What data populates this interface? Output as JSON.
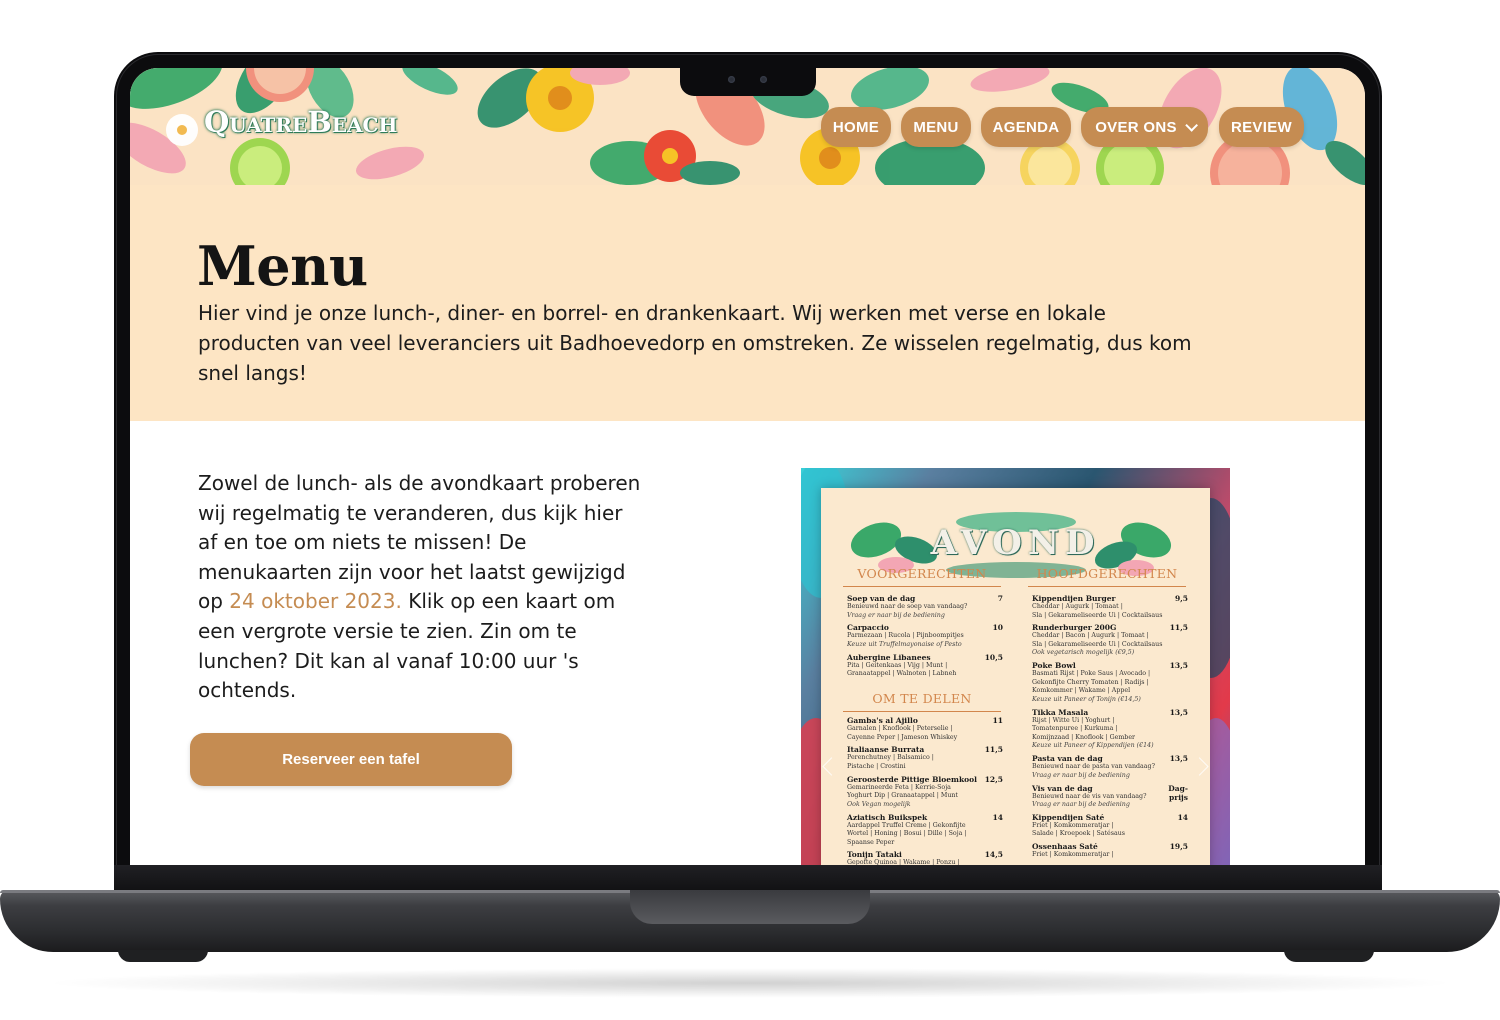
{
  "site": {
    "logo": "QuatreBeach",
    "nav": [
      {
        "label": "HOME"
      },
      {
        "label": "MENU"
      },
      {
        "label": "AGENDA"
      },
      {
        "label": "OVER ONS",
        "has_dropdown": true
      },
      {
        "label": "REVIEW"
      }
    ],
    "colors": {
      "accent": "#c58c52",
      "intro_bg": "#fde5c4"
    }
  },
  "intro": {
    "title": "Menu",
    "text": "Hier vind je onze lunch-, diner- en borrel- en drankenkaart. Wij werken met verse en lokale producten van veel leveranciers uit Badhoevedorp en omstreken. Ze wisselen regelmatig, dus kom snel langs!"
  },
  "content": {
    "text_before": "Zowel de lunch- als de avondkaart proberen wij regelmatig te veranderen, dus kijk hier af en toe om niets te missen! De menukaarten zijn voor het laatst gewijzigd op ",
    "date_link": "24 oktober 2023.",
    "text_after": " Klik op een kaart om een vergrote versie te zien. Zin om te lunchen? Dit kan al vanaf 10:00 uur 's ochtends.",
    "cta": "Reserveer een tafel"
  },
  "menu_card": {
    "title": "AVOND",
    "left_sections": [
      {
        "heading": "VOORGERECHTEN",
        "items": [
          {
            "name": "Soep van de dag",
            "price": "7",
            "desc": [
              "Benieuwd naar de soep van vandaag?"
            ],
            "note": [
              "Vraag er naar bij de bediening"
            ]
          },
          {
            "name": "Carpaccio",
            "price": "10",
            "desc": [
              "Parmezaan | Rucola | Pijnboompitjes"
            ],
            "note": [
              "Keuze uit Truffelmayonaise of Pesto"
            ]
          },
          {
            "name": "Aubergine Libanees",
            "price": "10,5",
            "desc": [
              "Pita | Geitenkaas | Vijg | Munt |",
              "Granaatappel | Walnoten | Labneh"
            ],
            "note": []
          }
        ]
      },
      {
        "heading": "OM TE DELEN",
        "items": [
          {
            "name": "Gamba's al Ajillo",
            "price": "11",
            "desc": [
              "Garnalen | Knoflook | Peterselie |",
              "Cayenne Peper | Jameson Whiskey"
            ],
            "note": []
          },
          {
            "name": "Italiaanse Burrata",
            "price": "11,5",
            "desc": [
              "Perenchutney | Balsamico |",
              "Pistache | Crostini"
            ],
            "note": []
          },
          {
            "name": "Geroosterde Pittige Bloemkool",
            "price": "12,5",
            "desc": [
              "Gemarineerde Feta | Kerrie-Soja",
              "Yoghurt Dip | Granaatappel | Munt"
            ],
            "note": [
              "Ook Vegan mogelijk"
            ]
          },
          {
            "name": "Aziatisch Buikspek",
            "price": "14",
            "desc": [
              "Aardappel Truffel Creme | Gekonfijte",
              "Wortel | Honing | Bosui | Dille | Soja |",
              "Spaanse Peper"
            ],
            "note": []
          },
          {
            "name": "Tonijn Tataki",
            "price": "14,5",
            "desc": [
              "Gepofte Quinoa | Wakame | Ponzu |"
            ],
            "note": []
          }
        ]
      }
    ],
    "right_sections": [
      {
        "heading": "HOOFDGERECHTEN",
        "items": [
          {
            "name": "Kippendijen Burger",
            "price": "9,5",
            "desc": [
              "Cheddar | Augurk | Tomaat |",
              "Sla | Gekarameliseerde Ui | Cocktailsaus"
            ],
            "note": []
          },
          {
            "name": "Runderburger 200G",
            "price": "11,5",
            "desc": [
              "Cheddar | Bacon | Augurk | Tomaat |",
              "Sla | Gekarameliseerde Ui | Cocktailsaus"
            ],
            "note": [
              "Ook vegetarisch mogelijk (€9,5)"
            ]
          },
          {
            "name": "Poke Bowl",
            "price": "13,5",
            "desc": [
              "Basmati Rijst | Poke Saus | Avocado |",
              "Gekonfijte Cherry Tomaten | Radijs |",
              "Komkommer | Wakame | Appel"
            ],
            "note": [
              "Keuze uit Paneer of Tonijn (€14,5)"
            ]
          },
          {
            "name": "Tikka Masala",
            "price": "13,5",
            "desc": [
              "Rijst | Witte Ui | Yoghurt |",
              "Tomatenpuree | Kurkuma |",
              "Komijnzaad | Knoflook | Gember"
            ],
            "note": [
              "Keuze uit Paneer of Kippendijen (€14)"
            ]
          },
          {
            "name": "Pasta van de dag",
            "price": "13,5",
            "desc": [
              "Benieuwd naar de pasta van vandaag?"
            ],
            "note": [
              "Vraag er naar bij de bediening"
            ]
          },
          {
            "name": "Vis van de dag",
            "price": "Dag-\nprijs",
            "desc": [
              "Benieuwd naar de vis van vandaag?"
            ],
            "note": [
              "Vraag er naar bij de bediening"
            ]
          },
          {
            "name": "Kippendijen Saté",
            "price": "14",
            "desc": [
              "Friet | Komkommeratjar |",
              "Salade | Kroepoek | Satésaus"
            ],
            "note": []
          },
          {
            "name": "Ossenhaas Saté",
            "price": "19,5",
            "desc": [
              "Friet | Komkommeratjar |"
            ],
            "note": []
          }
        ]
      }
    ]
  }
}
